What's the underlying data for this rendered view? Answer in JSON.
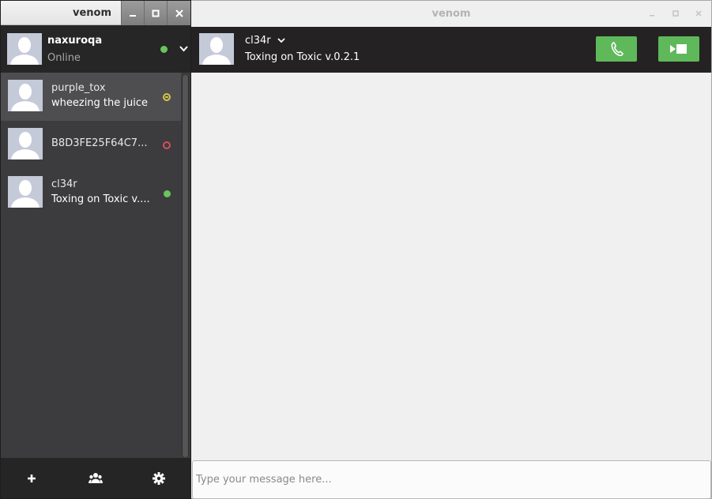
{
  "left_window": {
    "title": "venom",
    "user": {
      "name": "naxuroqa",
      "status": "Online"
    },
    "contacts": [
      {
        "name": "purple_tox",
        "message": "wheezing the juice",
        "status": "away"
      },
      {
        "name": "B8D3FE25F64C7...",
        "message": "",
        "status": "offline"
      },
      {
        "name": "cl34r",
        "message": "Toxing on Toxic v....",
        "status": "online"
      }
    ],
    "bottom_bar": [
      "add-friend-icon",
      "group-chat-icon",
      "settings-icon"
    ]
  },
  "right_window": {
    "title": "venom",
    "contact": {
      "name": "cl34r",
      "status_message": "Toxing on Toxic v.0.2.1"
    },
    "input": {
      "placeholder": "Type your message here...",
      "value": ""
    }
  },
  "colors": {
    "online": "#6bc25f",
    "away": "#d4c443",
    "offline": "#d4505a",
    "call_button": "#5fb85a",
    "sidebar": "#3c3c3e",
    "header": "#242222"
  }
}
